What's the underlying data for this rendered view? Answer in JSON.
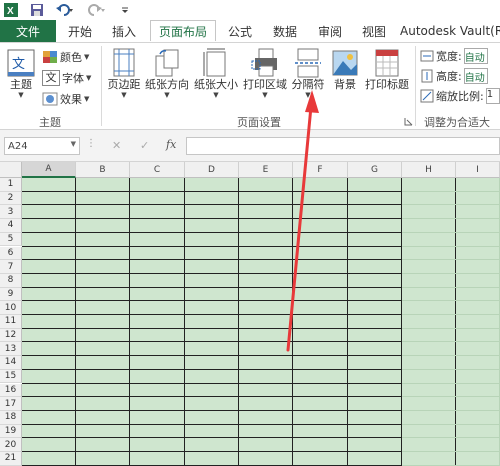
{
  "qat": {
    "app_icon": "excel-icon",
    "save_icon": "save-icon",
    "undo_icon": "undo-icon",
    "redo_icon": "redo-icon",
    "customize_icon": "customize-icon"
  },
  "tabs": {
    "file": "文件",
    "items": [
      "开始",
      "插入",
      "页面布局",
      "公式",
      "数据",
      "审阅",
      "视图",
      "Autodesk Vault(R"
    ]
  },
  "ribbon": {
    "themes": {
      "main_label": "主题",
      "colors": "颜色",
      "fonts": "字体",
      "effects": "效果",
      "group_label": "主题"
    },
    "page_setup": {
      "margins": "页边距",
      "orientation": "纸张方向",
      "size": "纸张大小",
      "print_area": "打印区域",
      "breaks": "分隔符",
      "background": "背景",
      "print_titles": "打印标题",
      "group_label": "页面设置",
      "launcher_icon": "dialog-launcher-icon"
    },
    "scale": {
      "width_label": "宽度:",
      "height_label": "高度:",
      "scale_label": "缩放比例:",
      "width_value": "自动",
      "height_value": "自动",
      "scale_value": "1",
      "group_label": "调整为合适大"
    }
  },
  "formula_bar": {
    "name_box": "A24",
    "cancel": "✕",
    "enter": "✓",
    "fx": "fx"
  },
  "grid": {
    "columns": [
      "A",
      "B",
      "C",
      "D",
      "E",
      "F",
      "G",
      "H",
      "I"
    ],
    "rows": [
      "1",
      "2",
      "3",
      "4",
      "5",
      "6",
      "7",
      "8",
      "9",
      "10",
      "11",
      "12",
      "13",
      "14",
      "15",
      "16",
      "17",
      "18",
      "19",
      "20",
      "21"
    ]
  },
  "annotation": {
    "arrow_color": "#e8393a"
  },
  "colors": {
    "excel_green": "#217346",
    "sheet_fill": "#cfe6cf"
  }
}
